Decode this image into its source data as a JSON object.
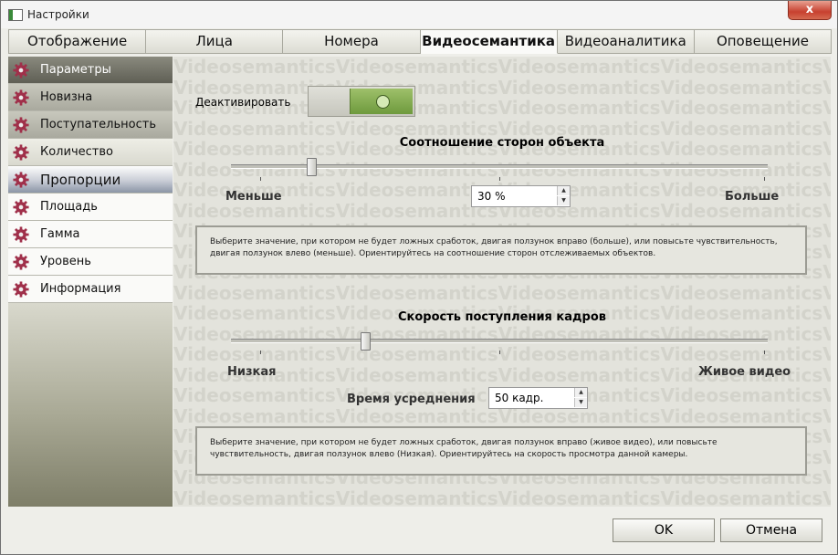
{
  "window": {
    "title": "Настройки",
    "close_glyph": "x"
  },
  "tabs": [
    {
      "label": "Отображение",
      "active": false
    },
    {
      "label": "Лица",
      "active": false
    },
    {
      "label": "Номера",
      "active": false
    },
    {
      "label": "Видеосемантика",
      "active": true
    },
    {
      "label": "Видеоаналитика",
      "active": false
    },
    {
      "label": "Оповещение",
      "active": false
    }
  ],
  "sidebar": {
    "items": [
      {
        "label": "Параметры",
        "icon": "gear-icon"
      },
      {
        "label": "Новизна",
        "icon": "gear-icon"
      },
      {
        "label": "Поступательность",
        "icon": "gear-icon"
      },
      {
        "label": "Количество",
        "icon": "gear-icon"
      },
      {
        "label": "Пропорции",
        "icon": "gear-icon",
        "selected": true
      },
      {
        "label": "Площадь",
        "icon": "gear-icon"
      },
      {
        "label": "Гамма",
        "icon": "gear-icon"
      },
      {
        "label": "Уровень",
        "icon": "gear-icon"
      },
      {
        "label": "Информация",
        "icon": "gear-icon"
      }
    ],
    "icon_color": "#a0304a"
  },
  "watermark": "Videosemantics",
  "deactivate": {
    "label": "Деактивировать",
    "state": "on"
  },
  "aspect": {
    "title": "Соотношение сторон объекта",
    "min_label": "Меньше",
    "max_label": "Больше",
    "value": "30 %",
    "slider_fraction": 0.15,
    "info": "Выберите значение, при котором не будет ложных сработок, двигая ползунок вправо (больше), или повысьте чувствительность, двигая ползунок влево (меньше). Ориентируйтесь на соотношение сторон отслеживаемых объектов."
  },
  "framerate": {
    "title": "Скорость поступления кадров",
    "min_label": "Низкая",
    "max_label": "Живое видео",
    "avg_label": "Время усреднения",
    "value": "50 кадр.",
    "slider_fraction": 0.25,
    "info": "Выберите значение, при котором не будет ложных сработок, двигая ползунок вправо (живое видео), или повысьте чувствительность, двигая ползунок влево (Низкая). Ориентируйтесь на скорость просмотра данной камеры."
  },
  "footer": {
    "ok_label": "OK",
    "cancel_label": "Отмена"
  },
  "colors": {
    "toggle_on": "#7ea84a",
    "accent": "#a0304a"
  }
}
